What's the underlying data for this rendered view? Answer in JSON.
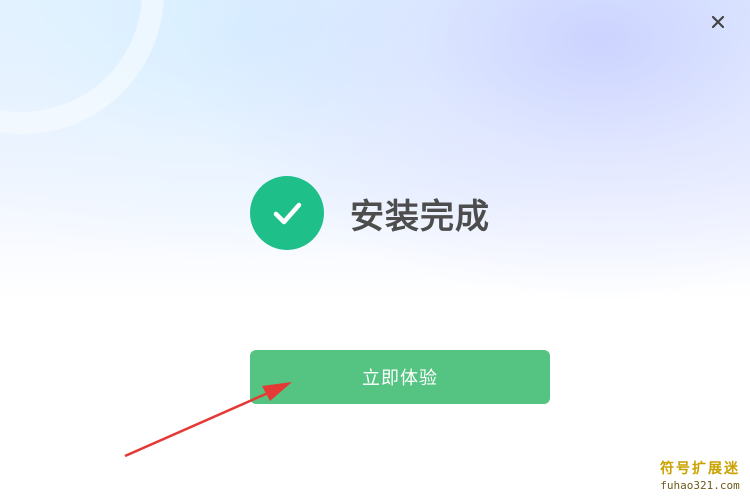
{
  "dialog": {
    "status_text": "安装完成",
    "primary_button_label": "立即体验",
    "close_symbol": "×",
    "icons": {
      "status": "check-circle-icon",
      "close": "close-icon"
    },
    "colors": {
      "success": "#1fbf8a",
      "button": "#55c482",
      "title_text": "#4d4d4d"
    }
  },
  "annotation": {
    "arrow_color": "#e53935"
  },
  "watermark": {
    "title": "符号扩展迷",
    "url": "fuhao321.com"
  }
}
